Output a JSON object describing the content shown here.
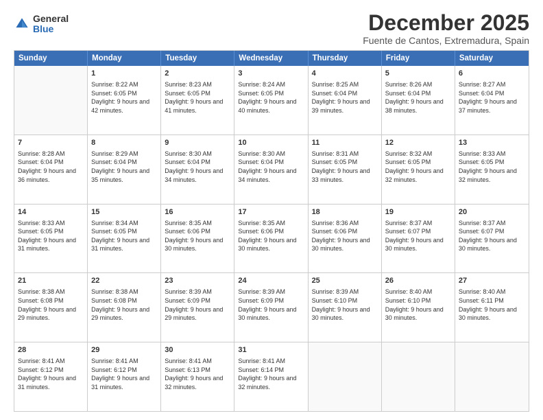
{
  "logo": {
    "general": "General",
    "blue": "Blue"
  },
  "title": "December 2025",
  "subtitle": "Fuente de Cantos, Extremadura, Spain",
  "header_days": [
    "Sunday",
    "Monday",
    "Tuesday",
    "Wednesday",
    "Thursday",
    "Friday",
    "Saturday"
  ],
  "weeks": [
    [
      {
        "day": "",
        "sunrise": "",
        "sunset": "",
        "daylight": ""
      },
      {
        "day": "1",
        "sunrise": "Sunrise: 8:22 AM",
        "sunset": "Sunset: 6:05 PM",
        "daylight": "Daylight: 9 hours and 42 minutes."
      },
      {
        "day": "2",
        "sunrise": "Sunrise: 8:23 AM",
        "sunset": "Sunset: 6:05 PM",
        "daylight": "Daylight: 9 hours and 41 minutes."
      },
      {
        "day": "3",
        "sunrise": "Sunrise: 8:24 AM",
        "sunset": "Sunset: 6:05 PM",
        "daylight": "Daylight: 9 hours and 40 minutes."
      },
      {
        "day": "4",
        "sunrise": "Sunrise: 8:25 AM",
        "sunset": "Sunset: 6:04 PM",
        "daylight": "Daylight: 9 hours and 39 minutes."
      },
      {
        "day": "5",
        "sunrise": "Sunrise: 8:26 AM",
        "sunset": "Sunset: 6:04 PM",
        "daylight": "Daylight: 9 hours and 38 minutes."
      },
      {
        "day": "6",
        "sunrise": "Sunrise: 8:27 AM",
        "sunset": "Sunset: 6:04 PM",
        "daylight": "Daylight: 9 hours and 37 minutes."
      }
    ],
    [
      {
        "day": "7",
        "sunrise": "Sunrise: 8:28 AM",
        "sunset": "Sunset: 6:04 PM",
        "daylight": "Daylight: 9 hours and 36 minutes."
      },
      {
        "day": "8",
        "sunrise": "Sunrise: 8:29 AM",
        "sunset": "Sunset: 6:04 PM",
        "daylight": "Daylight: 9 hours and 35 minutes."
      },
      {
        "day": "9",
        "sunrise": "Sunrise: 8:30 AM",
        "sunset": "Sunset: 6:04 PM",
        "daylight": "Daylight: 9 hours and 34 minutes."
      },
      {
        "day": "10",
        "sunrise": "Sunrise: 8:30 AM",
        "sunset": "Sunset: 6:04 PM",
        "daylight": "Daylight: 9 hours and 34 minutes."
      },
      {
        "day": "11",
        "sunrise": "Sunrise: 8:31 AM",
        "sunset": "Sunset: 6:05 PM",
        "daylight": "Daylight: 9 hours and 33 minutes."
      },
      {
        "day": "12",
        "sunrise": "Sunrise: 8:32 AM",
        "sunset": "Sunset: 6:05 PM",
        "daylight": "Daylight: 9 hours and 32 minutes."
      },
      {
        "day": "13",
        "sunrise": "Sunrise: 8:33 AM",
        "sunset": "Sunset: 6:05 PM",
        "daylight": "Daylight: 9 hours and 32 minutes."
      }
    ],
    [
      {
        "day": "14",
        "sunrise": "Sunrise: 8:33 AM",
        "sunset": "Sunset: 6:05 PM",
        "daylight": "Daylight: 9 hours and 31 minutes."
      },
      {
        "day": "15",
        "sunrise": "Sunrise: 8:34 AM",
        "sunset": "Sunset: 6:05 PM",
        "daylight": "Daylight: 9 hours and 31 minutes."
      },
      {
        "day": "16",
        "sunrise": "Sunrise: 8:35 AM",
        "sunset": "Sunset: 6:06 PM",
        "daylight": "Daylight: 9 hours and 30 minutes."
      },
      {
        "day": "17",
        "sunrise": "Sunrise: 8:35 AM",
        "sunset": "Sunset: 6:06 PM",
        "daylight": "Daylight: 9 hours and 30 minutes."
      },
      {
        "day": "18",
        "sunrise": "Sunrise: 8:36 AM",
        "sunset": "Sunset: 6:06 PM",
        "daylight": "Daylight: 9 hours and 30 minutes."
      },
      {
        "day": "19",
        "sunrise": "Sunrise: 8:37 AM",
        "sunset": "Sunset: 6:07 PM",
        "daylight": "Daylight: 9 hours and 30 minutes."
      },
      {
        "day": "20",
        "sunrise": "Sunrise: 8:37 AM",
        "sunset": "Sunset: 6:07 PM",
        "daylight": "Daylight: 9 hours and 30 minutes."
      }
    ],
    [
      {
        "day": "21",
        "sunrise": "Sunrise: 8:38 AM",
        "sunset": "Sunset: 6:08 PM",
        "daylight": "Daylight: 9 hours and 29 minutes."
      },
      {
        "day": "22",
        "sunrise": "Sunrise: 8:38 AM",
        "sunset": "Sunset: 6:08 PM",
        "daylight": "Daylight: 9 hours and 29 minutes."
      },
      {
        "day": "23",
        "sunrise": "Sunrise: 8:39 AM",
        "sunset": "Sunset: 6:09 PM",
        "daylight": "Daylight: 9 hours and 29 minutes."
      },
      {
        "day": "24",
        "sunrise": "Sunrise: 8:39 AM",
        "sunset": "Sunset: 6:09 PM",
        "daylight": "Daylight: 9 hours and 30 minutes."
      },
      {
        "day": "25",
        "sunrise": "Sunrise: 8:39 AM",
        "sunset": "Sunset: 6:10 PM",
        "daylight": "Daylight: 9 hours and 30 minutes."
      },
      {
        "day": "26",
        "sunrise": "Sunrise: 8:40 AM",
        "sunset": "Sunset: 6:10 PM",
        "daylight": "Daylight: 9 hours and 30 minutes."
      },
      {
        "day": "27",
        "sunrise": "Sunrise: 8:40 AM",
        "sunset": "Sunset: 6:11 PM",
        "daylight": "Daylight: 9 hours and 30 minutes."
      }
    ],
    [
      {
        "day": "28",
        "sunrise": "Sunrise: 8:41 AM",
        "sunset": "Sunset: 6:12 PM",
        "daylight": "Daylight: 9 hours and 31 minutes."
      },
      {
        "day": "29",
        "sunrise": "Sunrise: 8:41 AM",
        "sunset": "Sunset: 6:12 PM",
        "daylight": "Daylight: 9 hours and 31 minutes."
      },
      {
        "day": "30",
        "sunrise": "Sunrise: 8:41 AM",
        "sunset": "Sunset: 6:13 PM",
        "daylight": "Daylight: 9 hours and 32 minutes."
      },
      {
        "day": "31",
        "sunrise": "Sunrise: 8:41 AM",
        "sunset": "Sunset: 6:14 PM",
        "daylight": "Daylight: 9 hours and 32 minutes."
      },
      {
        "day": "",
        "sunrise": "",
        "sunset": "",
        "daylight": ""
      },
      {
        "day": "",
        "sunrise": "",
        "sunset": "",
        "daylight": ""
      },
      {
        "day": "",
        "sunrise": "",
        "sunset": "",
        "daylight": ""
      }
    ]
  ]
}
